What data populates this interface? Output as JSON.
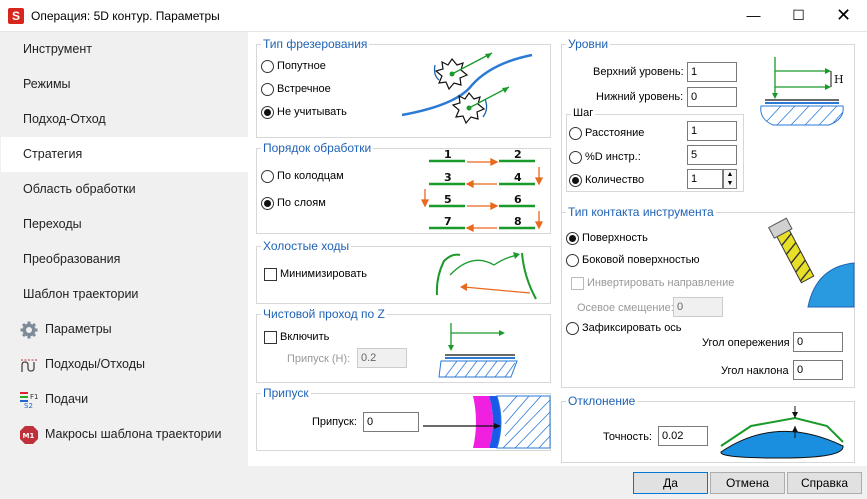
{
  "window": {
    "title": "Операция: 5D контур. Параметры",
    "app_icon": "S"
  },
  "sidebar": {
    "items": [
      {
        "label": "Инструмент"
      },
      {
        "label": "Режимы"
      },
      {
        "label": "Подход-Отход"
      },
      {
        "label": "Стратегия",
        "selected": true
      },
      {
        "label": "Область обработки"
      },
      {
        "label": "Переходы"
      },
      {
        "label": "Преобразования"
      },
      {
        "label": "Шаблон траектории"
      },
      {
        "label": "Параметры",
        "icon": "gear-icon"
      },
      {
        "label": "Подходы/Отходы",
        "icon": "approach-icon"
      },
      {
        "label": "Подачи",
        "icon": "feed-icon"
      },
      {
        "label": "Макросы шаблона траектории",
        "icon": "macro-icon"
      }
    ]
  },
  "milling_type": {
    "title": "Тип фрезерования",
    "options": [
      "Попутное",
      "Встречное",
      "Не учитывать"
    ],
    "selected": 2
  },
  "order": {
    "title": "Порядок обработки",
    "options": [
      "По колодцам",
      "По слоям"
    ],
    "selected": 1,
    "numbers": [
      "1",
      "2",
      "3",
      "4",
      "5",
      "6",
      "7",
      "8"
    ]
  },
  "idle": {
    "title": "Холостые ходы",
    "minimize_label": "Минимизировать",
    "minimize": false
  },
  "finish_z": {
    "title": "Чистовой проход по Z",
    "enable_label": "Включить",
    "enable": false,
    "allowance_label": "Припуск (H):",
    "allowance_value": "0.2"
  },
  "allowance": {
    "title": "Припуск",
    "label": "Припуск:",
    "value": "0"
  },
  "levels": {
    "title": "Уровни",
    "top_label": "Верхний уровень:",
    "top_value": "1",
    "bottom_label": "Нижний уровень:",
    "bottom_value": "0",
    "diagram_label": "H",
    "step": {
      "title": "Шаг",
      "distance_label": "Расстояние",
      "distance_value": "1",
      "percent_label": "%D инстр.:",
      "percent_value": "5",
      "count_label": "Количество",
      "count_value": "1",
      "selected": 2
    }
  },
  "contact": {
    "title": "Тип контакта инструмента",
    "surface_label": "Поверхность",
    "side_label": "Боковой поверхностью",
    "invert_label": "Инвертировать направление",
    "offset_label": "Осевое смещение:",
    "offset_value": "0",
    "fix_axis_label": "Зафиксировать ось",
    "lead_label": "Угол опережения",
    "lead_value": "0",
    "tilt_label": "Угол наклона",
    "tilt_value": "0",
    "selected": 0
  },
  "deviation": {
    "title": "Отклонение",
    "accuracy_label": "Точность:",
    "accuracy_value": "0.02"
  },
  "buttons": {
    "ok": "Да",
    "cancel": "Отмена",
    "help": "Справка"
  },
  "colors": {
    "accent": "#1e62b4",
    "green": "#1a9a2a",
    "orange": "#e8681c",
    "blue": "#2a7ad6"
  }
}
